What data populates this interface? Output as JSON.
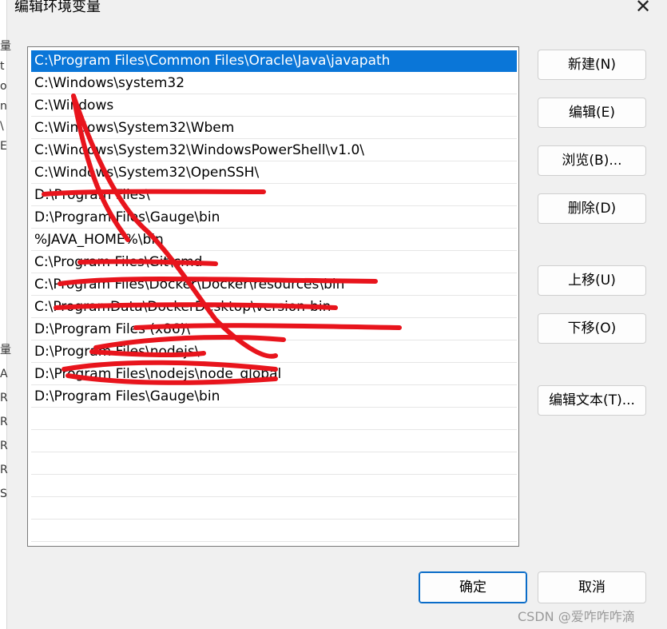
{
  "dialog": {
    "title": "编辑环境变量",
    "close_glyph": "✕"
  },
  "path_list": {
    "items": [
      "C:\\Program Files\\Common Files\\Oracle\\Java\\javapath",
      "C:\\Windows\\system32",
      "C:\\Windows",
      "C:\\Windows\\System32\\Wbem",
      "C:\\Windows\\System32\\WindowsPowerShell\\v1.0\\",
      "C:\\Windows\\System32\\OpenSSH\\",
      "D:\\Program Files\\",
      "D:\\Program Files\\Gauge\\bin",
      "%JAVA_HOME%\\bin",
      "C:\\Program Files\\Git\\cmd",
      "C:\\Program Files\\Docker\\Docker\\resources\\bin",
      "C:\\ProgramData\\DockerDesktop\\version-bin",
      "D:\\Program Files (x86)\\",
      "D:\\Program Files\\nodejs\\",
      "D:\\Program Files\\nodejs\\node_global",
      "D:\\Program Files\\Gauge\\bin"
    ],
    "selected_index": 0
  },
  "buttons": {
    "new": "新建(N)",
    "edit": "编辑(E)",
    "browse": "浏览(B)...",
    "delete": "删除(D)",
    "move_up": "上移(U)",
    "move_down": "下移(O)",
    "edit_text": "编辑文本(T)...",
    "ok": "确定",
    "cancel": "取消"
  },
  "colors": {
    "selection": "#0a76d8",
    "scribble": "#e8141c"
  },
  "watermark": "CSDN @爱咋咋咋滴"
}
